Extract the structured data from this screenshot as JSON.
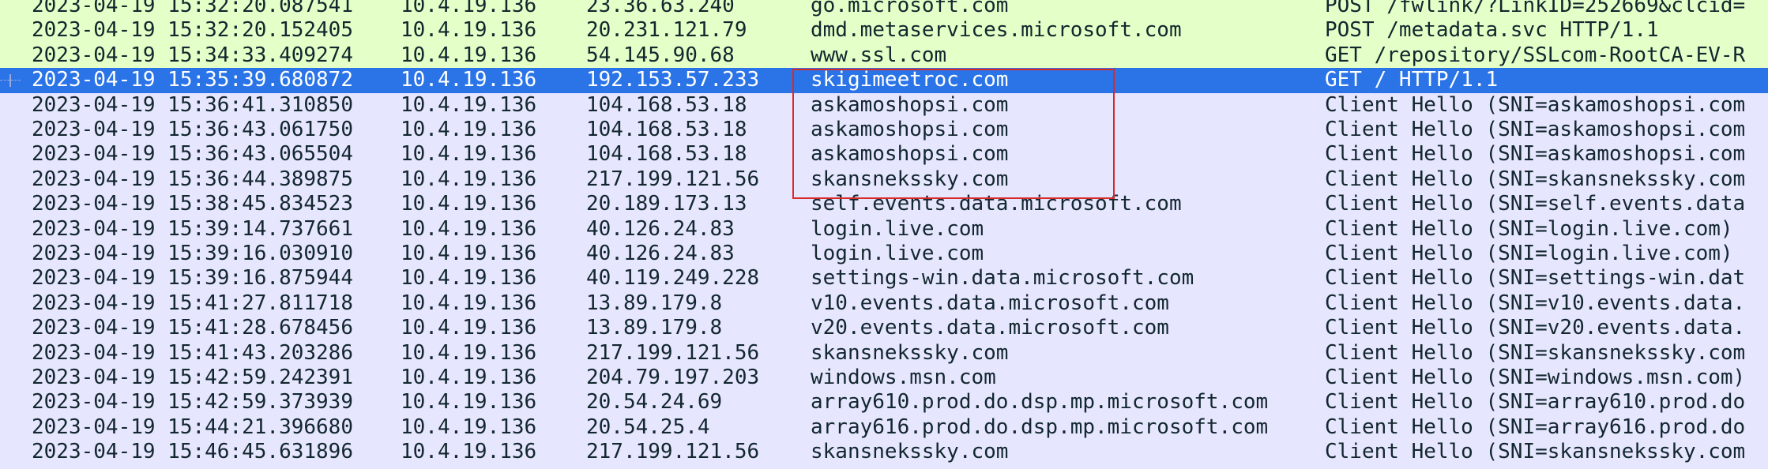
{
  "colors": {
    "http": "#e4ffc7",
    "tls": "#e7e6ff",
    "selected": "#2a74e8",
    "text": "#12272e",
    "selected_text": "#ffffff",
    "annotation": "#d92a2a"
  },
  "packets": [
    {
      "time": "2023-04-19 15:32:20.087541",
      "src": "10.4.19.136",
      "dst": "23.36.63.240",
      "host": "go.microsoft.com",
      "info": "POST /fwlink/?LinkID=252669&clcid=",
      "kind": "http",
      "selected": false
    },
    {
      "time": "2023-04-19 15:32:20.152405",
      "src": "10.4.19.136",
      "dst": "20.231.121.79",
      "host": "dmd.metaservices.microsoft.com",
      "info": "POST /metadata.svc HTTP/1.1",
      "kind": "http",
      "selected": false
    },
    {
      "time": "2023-04-19 15:34:33.409274",
      "src": "10.4.19.136",
      "dst": "54.145.90.68",
      "host": "www.ssl.com",
      "info": "GET /repository/SSLcom-RootCA-EV-R",
      "kind": "http",
      "selected": false
    },
    {
      "time": "2023-04-19 15:35:39.680872",
      "src": "10.4.19.136",
      "dst": "192.153.57.233",
      "host": "skigimeetroc.com",
      "info": "GET / HTTP/1.1",
      "kind": "http",
      "selected": true
    },
    {
      "time": "2023-04-19 15:36:41.310850",
      "src": "10.4.19.136",
      "dst": "104.168.53.18",
      "host": "askamoshopsi.com",
      "info": "Client Hello (SNI=askamoshopsi.com",
      "kind": "tls",
      "selected": false
    },
    {
      "time": "2023-04-19 15:36:43.061750",
      "src": "10.4.19.136",
      "dst": "104.168.53.18",
      "host": "askamoshopsi.com",
      "info": "Client Hello (SNI=askamoshopsi.com",
      "kind": "tls",
      "selected": false
    },
    {
      "time": "2023-04-19 15:36:43.065504",
      "src": "10.4.19.136",
      "dst": "104.168.53.18",
      "host": "askamoshopsi.com",
      "info": "Client Hello (SNI=askamoshopsi.com",
      "kind": "tls",
      "selected": false
    },
    {
      "time": "2023-04-19 15:36:44.389875",
      "src": "10.4.19.136",
      "dst": "217.199.121.56",
      "host": "skansnekssky.com",
      "info": "Client Hello (SNI=skansnekssky.com",
      "kind": "tls",
      "selected": false
    },
    {
      "time": "2023-04-19 15:38:45.834523",
      "src": "10.4.19.136",
      "dst": "20.189.173.13",
      "host": "self.events.data.microsoft.com",
      "info": "Client Hello (SNI=self.events.data",
      "kind": "tls",
      "selected": false
    },
    {
      "time": "2023-04-19 15:39:14.737661",
      "src": "10.4.19.136",
      "dst": "40.126.24.83",
      "host": "login.live.com",
      "info": "Client Hello (SNI=login.live.com)",
      "kind": "tls",
      "selected": false
    },
    {
      "time": "2023-04-19 15:39:16.030910",
      "src": "10.4.19.136",
      "dst": "40.126.24.83",
      "host": "login.live.com",
      "info": "Client Hello (SNI=login.live.com)",
      "kind": "tls",
      "selected": false
    },
    {
      "time": "2023-04-19 15:39:16.875944",
      "src": "10.4.19.136",
      "dst": "40.119.249.228",
      "host": "settings-win.data.microsoft.com",
      "info": "Client Hello (SNI=settings-win.dat",
      "kind": "tls",
      "selected": false
    },
    {
      "time": "2023-04-19 15:41:27.811718",
      "src": "10.4.19.136",
      "dst": "13.89.179.8",
      "host": "v10.events.data.microsoft.com",
      "info": "Client Hello (SNI=v10.events.data.",
      "kind": "tls",
      "selected": false
    },
    {
      "time": "2023-04-19 15:41:28.678456",
      "src": "10.4.19.136",
      "dst": "13.89.179.8",
      "host": "v20.events.data.microsoft.com",
      "info": "Client Hello (SNI=v20.events.data.",
      "kind": "tls",
      "selected": false
    },
    {
      "time": "2023-04-19 15:41:43.203286",
      "src": "10.4.19.136",
      "dst": "217.199.121.56",
      "host": "skansnekssky.com",
      "info": "Client Hello (SNI=skansnekssky.com",
      "kind": "tls",
      "selected": false
    },
    {
      "time": "2023-04-19 15:42:59.242391",
      "src": "10.4.19.136",
      "dst": "204.79.197.203",
      "host": "windows.msn.com",
      "info": "Client Hello (SNI=windows.msn.com)",
      "kind": "tls",
      "selected": false
    },
    {
      "time": "2023-04-19 15:42:59.373939",
      "src": "10.4.19.136",
      "dst": "20.54.24.69",
      "host": "array610.prod.do.dsp.mp.microsoft.com",
      "info": "Client Hello (SNI=array610.prod.do",
      "kind": "tls",
      "selected": false
    },
    {
      "time": "2023-04-19 15:44:21.396680",
      "src": "10.4.19.136",
      "dst": "20.54.25.4",
      "host": "array616.prod.do.dsp.mp.microsoft.com",
      "info": "Client Hello (SNI=array616.prod.do",
      "kind": "tls",
      "selected": false
    },
    {
      "time": "2023-04-19 15:46:45.631896",
      "src": "10.4.19.136",
      "dst": "217.199.121.56",
      "host": "skansnekssky.com",
      "info": "Client Hello (SNI=skansnekssky.com",
      "kind": "tls",
      "selected": false
    }
  ]
}
